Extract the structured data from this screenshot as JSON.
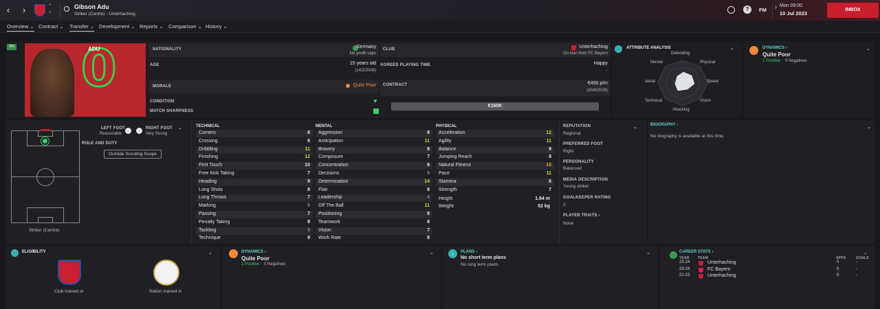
{
  "header": {
    "name": "Gibson Adu",
    "subtitle": "Striker (Centre) - Unterhaching",
    "time": "Mon 09:00",
    "date": "10 Jul 2023",
    "fm": "FM",
    "inbox": "INBOX"
  },
  "tabs": [
    "Overview",
    "Contract",
    "Transfer",
    "Development",
    "Reports",
    "Comparison",
    "History"
  ],
  "profile": {
    "badge": "0%",
    "surname": "ADU",
    "shirt_number": "0",
    "nationality_label": "NATIONALITY",
    "nationality": "Germany",
    "youth_caps": "No youth caps",
    "club_label": "CLUB",
    "club": "Unterhaching",
    "loan": "On loan from FC Bayern",
    "age_label": "AGE",
    "age": "15 years old",
    "dob": "(14/2/2008)",
    "playing_time_label": "AGREED PLAYING TIME",
    "happy": "Happy",
    "dash": "-",
    "morale_label": "MORALE",
    "morale": "Quite Poor",
    "contract_label": "CONTRACT",
    "wage": "€450 p/m",
    "contract_end": "(30/6/2026)",
    "condition_label": "CONDITION",
    "sharpness_label": "MATCH SHARPNESS",
    "value": "€160K"
  },
  "attr_analysis": {
    "title": "ATTRIBUTE ANALYSIS",
    "axes": [
      "Defending",
      "Physical",
      "Speed",
      "Vision",
      "Attacking",
      "Technical",
      "Aerial",
      "Mental"
    ]
  },
  "dynamics": {
    "title": "DYNAMICS",
    "status": "Quite Poor",
    "positives": "1 Positive",
    "negatives": "0 Negatives"
  },
  "pitch": {
    "position_label": "Striker (Centre)",
    "left_foot_label": "LEFT FOOT",
    "left_foot": "Reasonable",
    "right_foot_label": "RIGHT FOOT",
    "right_foot": "Very Strong",
    "role_label": "ROLE AND DUTY",
    "scouting": "Outside Scouting Scope"
  },
  "technical": {
    "title": "TECHNICAL",
    "rows": [
      [
        "Corners",
        "8"
      ],
      [
        "Crossing",
        "8"
      ],
      [
        "Dribbling",
        "11"
      ],
      [
        "Finishing",
        "12"
      ],
      [
        "First Touch",
        "10"
      ],
      [
        "Free Kick Taking",
        "7"
      ],
      [
        "Heading",
        "9"
      ],
      [
        "Long Shots",
        "8"
      ],
      [
        "Long Throws",
        "7"
      ],
      [
        "Marking",
        "5"
      ],
      [
        "Passing",
        "7"
      ],
      [
        "Penalty Taking",
        "8"
      ],
      [
        "Tackling",
        "5"
      ],
      [
        "Technique",
        "9"
      ]
    ]
  },
  "mental": {
    "title": "MENTAL",
    "rows": [
      [
        "Aggression",
        "9"
      ],
      [
        "Anticipation",
        "11"
      ],
      [
        "Bravery",
        "8"
      ],
      [
        "Composure",
        "7"
      ],
      [
        "Concentration",
        "6"
      ],
      [
        "Decisions",
        "5"
      ],
      [
        "Determination",
        "14"
      ],
      [
        "Flair",
        "8"
      ],
      [
        "Leadership",
        "4"
      ],
      [
        "Off The Ball",
        "11"
      ],
      [
        "Positioning",
        "9"
      ],
      [
        "Teamwork",
        "8"
      ],
      [
        "Vision",
        "7"
      ],
      [
        "Work Rate",
        "8"
      ]
    ]
  },
  "physical": {
    "title": "PHYSICAL",
    "rows": [
      [
        "Acceleration",
        "12"
      ],
      [
        "Agility",
        "11"
      ],
      [
        "Balance",
        "9"
      ],
      [
        "Jumping Reach",
        "8"
      ],
      [
        "Natural Fitness",
        "15"
      ],
      [
        "Pace",
        "11"
      ],
      [
        "Stamina",
        "6"
      ],
      [
        "Strength",
        "7"
      ]
    ],
    "height_label": "Height",
    "height": "1.64 m",
    "weight_label": "Weight",
    "weight": "52 kg"
  },
  "info": {
    "reputation_label": "REPUTATION",
    "reputation": "Regional",
    "foot_label": "PREFERRED FOOT",
    "foot": "Right",
    "personality_label": "PERSONALITY",
    "personality": "Balanced",
    "media_label": "MEDIA DESCRIPTION",
    "media": "Young striker",
    "gk_label": "GOALKEEPER RATING",
    "gk": "2",
    "traits_label": "PLAYER TRAITS",
    "traits": "None"
  },
  "biography": {
    "title": "BIOGRAPHY",
    "text": "No biography is available at this time."
  },
  "eligibility": {
    "title": "ELIGIBILITY",
    "club_trained": "Club trained at",
    "nation_trained": "Nation trained in"
  },
  "plans": {
    "title": "PLANS",
    "short": "No short term plans",
    "long": "No long term plans"
  },
  "career": {
    "title": "CAREER STATS",
    "cols": [
      "YEAR",
      "TEAM",
      "APPS",
      "GOALS"
    ],
    "rows": [
      [
        "23-24",
        "Unterhaching",
        "0",
        "-"
      ],
      [
        "23-24",
        "FC Bayern",
        "0",
        "-"
      ],
      [
        "21-23",
        "Unterhaching",
        "0",
        "-"
      ]
    ]
  },
  "colors": {
    "accent_red": "#c81e2e",
    "yellow": "#e8d23c",
    "green": "#3ccf6a",
    "teal": "#5fd6c4",
    "orange": "#f08a3a"
  }
}
